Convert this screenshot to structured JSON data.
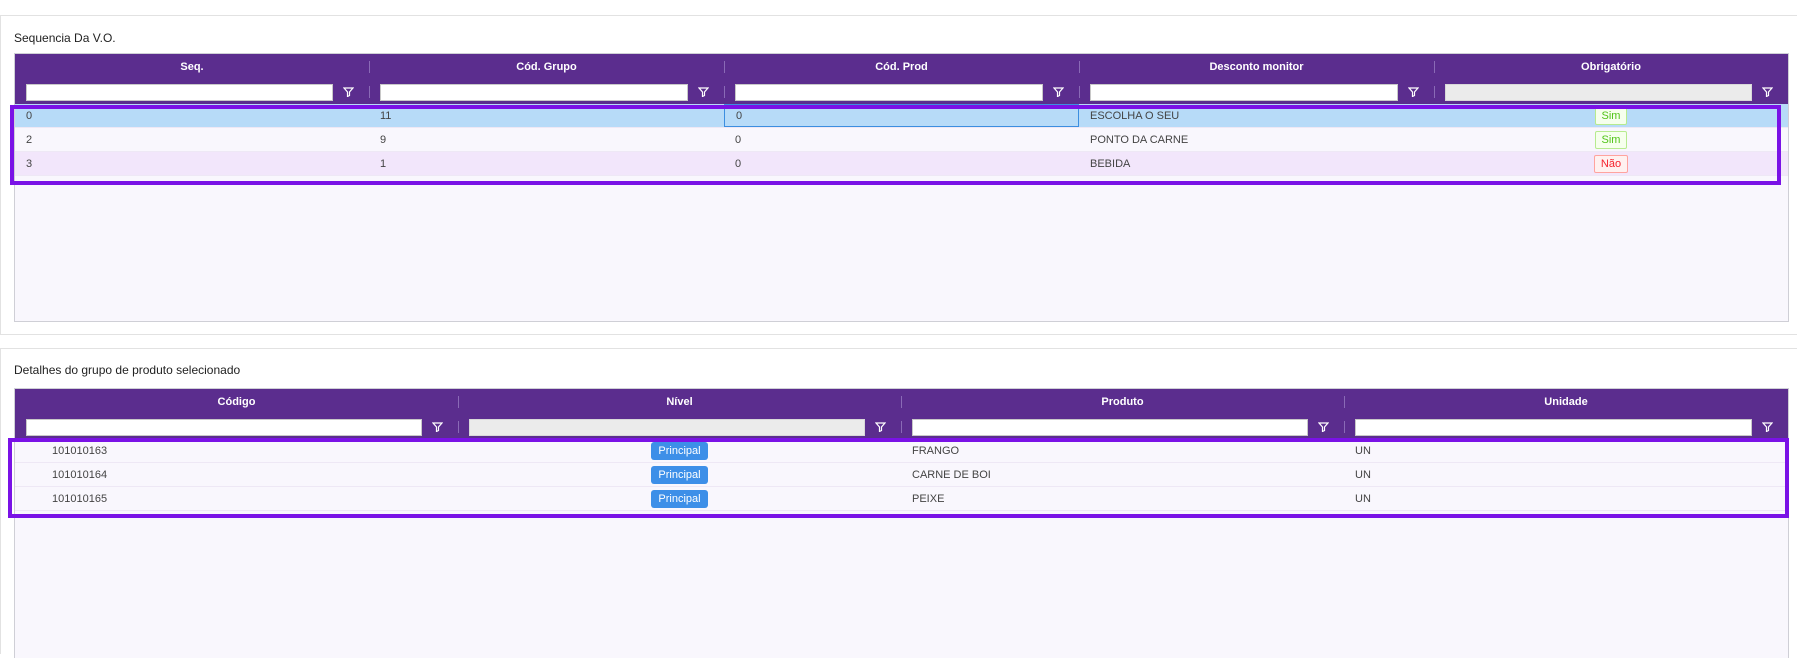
{
  "panel1": {
    "title": "Sequencia Da V.O.",
    "columns": [
      "Seq.",
      "Cód. Grupo",
      "Cód. Prod",
      "Desconto monitor",
      "Obrigatório"
    ],
    "rows": [
      {
        "seq": "0",
        "grupo": "11",
        "prod": "0",
        "desconto": "ESCOLHA O SEU",
        "obrigatorio": "Sim"
      },
      {
        "seq": "2",
        "grupo": "9",
        "prod": "0",
        "desconto": "PONTO DA CARNE",
        "obrigatorio": "Sim"
      },
      {
        "seq": "3",
        "grupo": "1",
        "prod": "0",
        "desconto": "BEBIDA",
        "obrigatorio": "Não"
      }
    ]
  },
  "panel2": {
    "title": "Detalhes do grupo de produto selecionado",
    "columns": [
      "Código",
      "Nível",
      "Produto",
      "Unidade"
    ],
    "rows": [
      {
        "codigo": "101010163",
        "nivel": "Principal",
        "produto": "FRANGO",
        "unidade": "UN"
      },
      {
        "codigo": "101010164",
        "nivel": "Principal",
        "produto": "CARNE DE BOI",
        "unidade": "UN"
      },
      {
        "codigo": "101010165",
        "nivel": "Principal",
        "produto": "PEIXE",
        "unidade": "UN"
      }
    ]
  },
  "colors": {
    "header": "#5b2d8e",
    "selected_row": "#b7dbf8",
    "highlight_border": "#7a12e6",
    "badge_blue": "#3d8fe8"
  },
  "icons": {
    "filter": "filter-icon"
  }
}
